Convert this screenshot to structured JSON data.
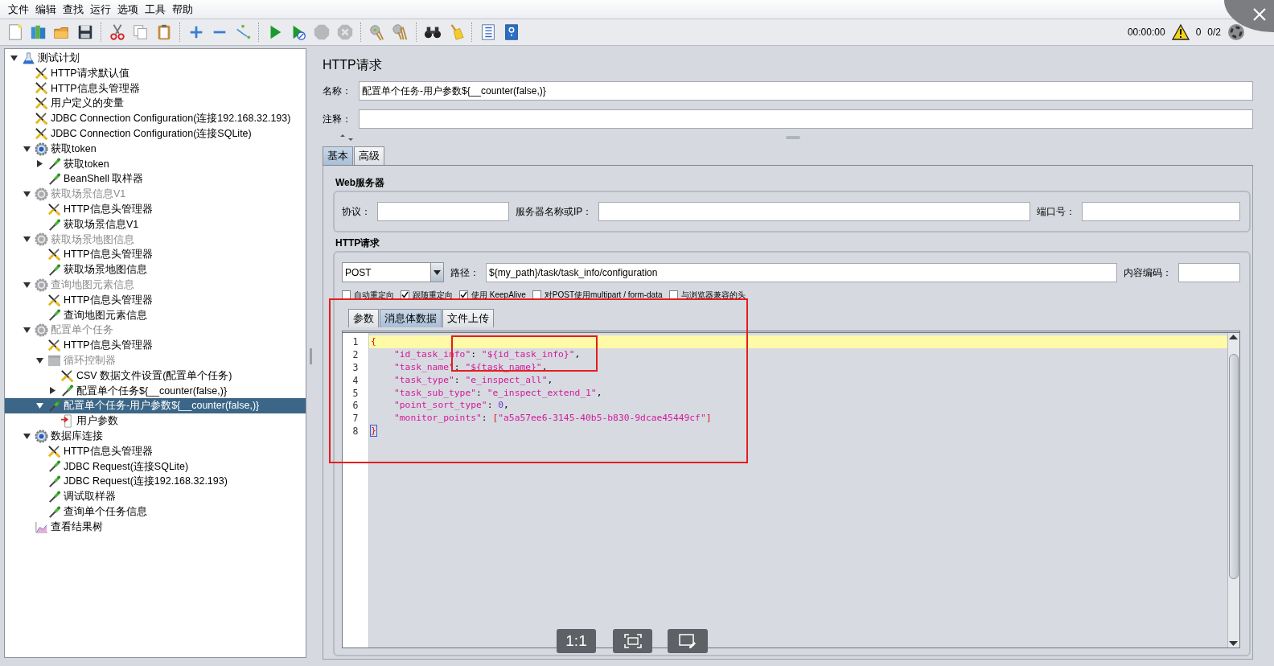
{
  "menu": [
    "文件",
    "编辑",
    "查找",
    "运行",
    "选项",
    "工具",
    "帮助"
  ],
  "toolbar": [
    {
      "kind": "new",
      "disabled": false
    },
    {
      "kind": "templates",
      "disabled": false
    },
    {
      "kind": "open",
      "disabled": false
    },
    {
      "kind": "save",
      "disabled": false
    },
    {
      "kind": "separator"
    },
    {
      "kind": "cut",
      "disabled": false
    },
    {
      "kind": "copy",
      "disabled": false
    },
    {
      "kind": "paste",
      "disabled": false
    },
    {
      "kind": "separator"
    },
    {
      "kind": "expand",
      "disabled": false
    },
    {
      "kind": "collapse",
      "disabled": false
    },
    {
      "kind": "toggle",
      "disabled": false
    },
    {
      "kind": "separator"
    },
    {
      "kind": "start",
      "disabled": false
    },
    {
      "kind": "start-no-timers",
      "disabled": false
    },
    {
      "kind": "stop",
      "disabled": true
    },
    {
      "kind": "shutdown",
      "disabled": true
    },
    {
      "kind": "separator"
    },
    {
      "kind": "clear",
      "disabled": false
    },
    {
      "kind": "clear-all",
      "disabled": false
    },
    {
      "kind": "separator"
    },
    {
      "kind": "search",
      "disabled": false
    },
    {
      "kind": "reset-search",
      "disabled": false
    },
    {
      "kind": "separator"
    },
    {
      "kind": "function-helper",
      "disabled": false
    },
    {
      "kind": "help",
      "disabled": false
    }
  ],
  "status": {
    "elapsed": "00:00:00",
    "warnings": "0",
    "threads": "0/2"
  },
  "tree": [
    {
      "label": "测试计划",
      "kind": "plan",
      "disabled": false,
      "selected": false,
      "expanded": true,
      "children": [
        {
          "label": "HTTP请求默认值",
          "kind": "config",
          "disabled": false,
          "selected": false
        },
        {
          "label": "HTTP信息头管理器",
          "kind": "config",
          "disabled": false,
          "selected": false
        },
        {
          "label": "用户定义的变量",
          "kind": "config",
          "disabled": false,
          "selected": false
        },
        {
          "label": "JDBC Connection Configuration(连接192.168.32.193)",
          "kind": "config",
          "disabled": false,
          "selected": false
        },
        {
          "label": "JDBC Connection Configuration(连接SQLite)",
          "kind": "config",
          "disabled": false,
          "selected": false
        },
        {
          "label": "获取token",
          "kind": "threadgroup",
          "disabled": false,
          "selected": false,
          "expanded": true,
          "children": [
            {
              "label": "获取token",
              "kind": "sampler",
              "disabled": false,
              "selected": false,
              "expanded": false
            },
            {
              "label": "BeanShell 取样器",
              "kind": "sampler",
              "disabled": false,
              "selected": false
            }
          ]
        },
        {
          "label": "获取场景信息V1",
          "kind": "threadgroup",
          "disabled": true,
          "selected": false,
          "expanded": true,
          "children": [
            {
              "label": "HTTP信息头管理器",
              "kind": "config",
              "disabled": false,
              "selected": false
            },
            {
              "label": "获取场景信息V1",
              "kind": "sampler",
              "disabled": false,
              "selected": false
            }
          ]
        },
        {
          "label": "获取场景地图信息",
          "kind": "threadgroup",
          "disabled": true,
          "selected": false,
          "expanded": true,
          "children": [
            {
              "label": "HTTP信息头管理器",
              "kind": "config",
              "disabled": false,
              "selected": false
            },
            {
              "label": "获取场景地图信息",
              "kind": "sampler",
              "disabled": false,
              "selected": false
            }
          ]
        },
        {
          "label": "查询地图元素信息",
          "kind": "threadgroup",
          "disabled": true,
          "selected": false,
          "expanded": true,
          "children": [
            {
              "label": "HTTP信息头管理器",
              "kind": "config",
              "disabled": false,
              "selected": false
            },
            {
              "label": "查询地图元素信息",
              "kind": "sampler",
              "disabled": false,
              "selected": false
            }
          ]
        },
        {
          "label": "配置单个任务",
          "kind": "threadgroup",
          "disabled": true,
          "selected": false,
          "expanded": true,
          "children": [
            {
              "label": "HTTP信息头管理器",
              "kind": "config",
              "disabled": false,
              "selected": false
            },
            {
              "label": "循环控制器",
              "kind": "loop",
              "disabled": true,
              "selected": false,
              "expanded": true,
              "children": [
                {
                  "label": "CSV 数据文件设置(配置单个任务)",
                  "kind": "config",
                  "disabled": false,
                  "selected": false
                },
                {
                  "label": "配置单个任务${__counter(false,)}",
                  "kind": "sampler",
                  "disabled": false,
                  "selected": false,
                  "expanded": false
                }
              ]
            },
            {
              "label": "配置单个任务-用户参数${__counter(false,)}",
              "kind": "sampler",
              "disabled": false,
              "selected": true,
              "expanded": true,
              "children": [
                {
                  "label": "用户参数",
                  "kind": "preprocessor",
                  "disabled": false,
                  "selected": false
                }
              ]
            }
          ]
        },
        {
          "label": "数据库连接",
          "kind": "threadgroup",
          "disabled": false,
          "selected": false,
          "expanded": true,
          "children": [
            {
              "label": "HTTP信息头管理器",
              "kind": "config",
              "disabled": false,
              "selected": false
            },
            {
              "label": "JDBC Request(连接SQLite)",
              "kind": "sampler",
              "disabled": false,
              "selected": false
            },
            {
              "label": "JDBC Request(连接192.168.32.193)",
              "kind": "sampler",
              "disabled": false,
              "selected": false
            },
            {
              "label": "调试取样器",
              "kind": "sampler",
              "disabled": false,
              "selected": false
            },
            {
              "label": "查询单个任务信息",
              "kind": "sampler",
              "disabled": false,
              "selected": false
            }
          ]
        },
        {
          "label": "查看结果树",
          "kind": "listener",
          "disabled": false,
          "selected": false
        }
      ]
    }
  ],
  "panel": {
    "title": "HTTP请求",
    "name_label": "名称：",
    "name": "配置单个任务-用户参数${__counter(false,)}",
    "comment_label": "注释：",
    "tabs": [
      {
        "label": "基本",
        "selected": true
      },
      {
        "label": "高级",
        "selected": false
      }
    ],
    "web_server": {
      "title": "Web服务器",
      "fields": [
        {
          "label": "协议："
        },
        {
          "label": "服务器名称或IP："
        },
        {
          "label": "端口号："
        }
      ]
    },
    "http_request": {
      "title": "HTTP请求",
      "method": "POST",
      "path_label": "路径：",
      "path": "${my_path}/task/task_info/configuration",
      "encoding_label": "内容编码：",
      "options": [
        {
          "label": "自动重定向",
          "checked": false
        },
        {
          "label": "跟随重定向",
          "checked": true
        },
        {
          "label": "使用 KeepAlive",
          "checked": true
        },
        {
          "label": "对POST使用multipart / form-data",
          "checked": false
        },
        {
          "label": "与浏览器兼容的头",
          "checked": false
        }
      ],
      "tabs": [
        {
          "label": "参数",
          "selected": false
        },
        {
          "label": "消息体数据",
          "selected": true
        },
        {
          "label": "文件上传",
          "selected": false
        }
      ],
      "body_lines": [
        {
          "number": "1",
          "highlighted": true,
          "indent": false,
          "tokens": [
            {
              "kind": "bracket",
              "text": "{"
            }
          ]
        },
        {
          "number": "2",
          "highlighted": false,
          "indent": true,
          "tokens": [
            {
              "kind": "string",
              "text": "\"id_task_info\""
            },
            {
              "kind": "punct",
              "text": ": "
            },
            {
              "kind": "string",
              "text": "\"${id_task_info}\""
            },
            {
              "kind": "punct",
              "text": ","
            }
          ]
        },
        {
          "number": "3",
          "highlighted": false,
          "indent": true,
          "tokens": [
            {
              "kind": "string",
              "text": "\"task_name\""
            },
            {
              "kind": "punct",
              "text": ": "
            },
            {
              "kind": "string",
              "text": "\"${task_name}\""
            },
            {
              "kind": "punct",
              "text": ","
            }
          ]
        },
        {
          "number": "4",
          "highlighted": false,
          "indent": true,
          "tokens": [
            {
              "kind": "string",
              "text": "\"task_type\""
            },
            {
              "kind": "punct",
              "text": ": "
            },
            {
              "kind": "string",
              "text": "\"e_inspect_all\""
            },
            {
              "kind": "punct",
              "text": ","
            }
          ]
        },
        {
          "number": "5",
          "highlighted": false,
          "indent": true,
          "tokens": [
            {
              "kind": "string",
              "text": "\"task_sub_type\""
            },
            {
              "kind": "punct",
              "text": ": "
            },
            {
              "kind": "string",
              "text": "\"e_inspect_extend_1\""
            },
            {
              "kind": "punct",
              "text": ","
            }
          ]
        },
        {
          "number": "6",
          "highlighted": false,
          "indent": true,
          "tokens": [
            {
              "kind": "string",
              "text": "\"point_sort_type\""
            },
            {
              "kind": "punct",
              "text": ": "
            },
            {
              "kind": "number",
              "text": "0"
            },
            {
              "kind": "punct",
              "text": ","
            }
          ]
        },
        {
          "number": "7",
          "highlighted": false,
          "indent": true,
          "tokens": [
            {
              "kind": "string",
              "text": "\"monitor_points\""
            },
            {
              "kind": "punct",
              "text": ": "
            },
            {
              "kind": "bracket",
              "text": "["
            },
            {
              "kind": "string",
              "text": "\"a5a57ee6-3145-40b5-b830-9dcae45449cf\""
            },
            {
              "kind": "bracket",
              "text": "]"
            }
          ]
        },
        {
          "number": "8",
          "highlighted": false,
          "indent": false,
          "tokens": [
            {
              "kind": "bracket-match",
              "text": "}"
            }
          ]
        }
      ]
    }
  },
  "annotations": [
    {
      "kind": "highlight-box"
    },
    {
      "kind": "highlight-box"
    }
  ],
  "viewer_controls": [
    {
      "kind": "actual-size",
      "label": "1:1"
    },
    {
      "kind": "fit"
    },
    {
      "kind": "annotate"
    }
  ]
}
